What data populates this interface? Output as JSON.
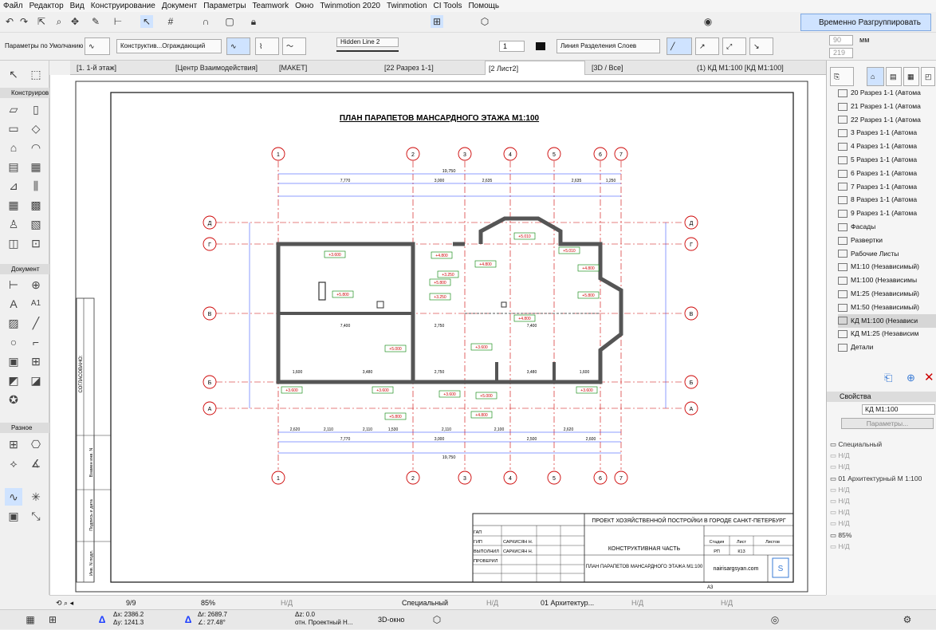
{
  "menu": [
    "Файл",
    "Редактор",
    "Вид",
    "Конструирование",
    "Документ",
    "Параметры",
    "Teamwork",
    "Окно",
    "Twinmotion 2020",
    "Twinmotion",
    "CI Tools",
    "Помощь"
  ],
  "toolbar": {
    "group_button": "Временно Разгруппировать",
    "default_params": "Параметры по Умолчанию",
    "construct_dropdown": "Конструктив...Ограждающий",
    "hidden_line": "Hidden Line 2",
    "pen_number": "1",
    "layer_line": "Линия Разделения Слоев",
    "unit_mm": "мм",
    "val_90": "90",
    "val_219": "219"
  },
  "tabs": [
    {
      "label": "[1. 1-й этаж]"
    },
    {
      "label": "[Центр Взаимодействия]"
    },
    {
      "label": "[МАКЕТ]"
    },
    {
      "label": "[22 Разрез 1-1]"
    },
    {
      "label": "[2 Лист2]"
    },
    {
      "label": "[3D / Все]"
    },
    {
      "label": "(1) КД М1:100 [КД М1:100]"
    }
  ],
  "left_sections": {
    "construct": "Конструиров",
    "document": "Документ",
    "misc": "Разное",
    "a1_label": "A1"
  },
  "drawing": {
    "title": "ПЛАН ПАРАПЕТОВ МАНСАРДНОГО ЭТАЖА  М1:100",
    "axes_vertical": [
      "1",
      "2",
      "3",
      "4",
      "5",
      "6",
      "7"
    ],
    "axes_horizontal": [
      "Д",
      "Г",
      "В",
      "Б",
      "А"
    ],
    "dim_total": "19,750",
    "dims_top": [
      "7,770",
      "3,000",
      "2,635",
      "2,635",
      "1,250"
    ],
    "dims_bottom_row1": [
      "2,620",
      "2,110",
      "2,110",
      "1,530",
      "2,110",
      "2,100",
      "2,620"
    ],
    "dims_bottom_row2": [
      "7,770",
      "3,000",
      "2,500",
      "2,600"
    ],
    "dims_inner": [
      "7,400",
      "2,750",
      "7,400",
      "1,600",
      "3,480",
      "2,750",
      "3,480",
      "1,600"
    ],
    "marks": [
      "+3.600",
      "+3.600",
      "+3.600",
      "+3.600",
      "+3.600",
      "+3.600",
      "+4.800",
      "+4.800",
      "+4.800",
      "+4.800",
      "+5.000",
      "+5.000",
      "+5.800",
      "+5.800",
      "+5.800",
      "+5.800",
      "+3.250",
      "+3.250",
      "+4.800",
      "+5.010",
      "+5.010"
    ],
    "side_label": "СОГЛАСОВАНО:",
    "stamp_side": [
      "Взамен инв. N",
      "Подпись и дата",
      "Инв. N подл."
    ],
    "stamp": {
      "project": "ПРОЕКТ ХОЗЯЙСТВЕННОЙ ПОСТРОЙКИ В ГОРОДЕ САНКТ-ПЕТЕРБУРГ",
      "part": "КОНСТРУКТИВНАЯ ЧАСТЬ",
      "stage_h": "Стадия",
      "sheet_h": "Лист",
      "sheets_h": "Листов",
      "stage": "РП",
      "sheet": "К13",
      "sheet_title": "ПЛАН ПАРАПЕТОВ МАНСАРДНОГО ЭТАЖА М1:100",
      "site": "nairisargsyan.com",
      "rows": [
        {
          "role": "ГАП",
          "name": ""
        },
        {
          "role": "ГИП",
          "name": "САРКИСЯН Н."
        },
        {
          "role": "ВЫПОЛНИЛ",
          "name": "САРКИСЯН Н."
        },
        {
          "role": "ПРОВЕРИЛ",
          "name": ""
        }
      ],
      "format": "А3"
    }
  },
  "navigator": {
    "items": [
      {
        "label": "20 Разрез 1-1 (Автома",
        "sel": false
      },
      {
        "label": "21 Разрез 1-1 (Автома",
        "sel": false
      },
      {
        "label": "22 Разрез 1-1 (Автома",
        "sel": false
      },
      {
        "label": "3 Разрез 1-1 (Автома",
        "sel": false
      },
      {
        "label": "4 Разрез 1-1 (Автома",
        "sel": false
      },
      {
        "label": "5 Разрез 1-1 (Автома",
        "sel": false
      },
      {
        "label": "6 Разрез 1-1 (Автома",
        "sel": false
      },
      {
        "label": "7 Разрез 1-1 (Автома",
        "sel": false
      },
      {
        "label": "8 Разрез 1-1 (Автома",
        "sel": false
      },
      {
        "label": "9 Разрез 1-1 (Автома",
        "sel": false
      },
      {
        "label": "Фасады",
        "sel": false
      },
      {
        "label": "Развертки",
        "sel": false
      },
      {
        "label": "Рабочие Листы",
        "sel": false
      },
      {
        "label": "М1:10 (Независимый)",
        "sel": false
      },
      {
        "label": "М1:100 (Независимы",
        "sel": false
      },
      {
        "label": "М1:25 (Независимый)",
        "sel": false
      },
      {
        "label": "М1:50 (Независимый)",
        "sel": false
      },
      {
        "label": "КД М1:100 (Независи",
        "sel": true
      },
      {
        "label": "КД М1:25 (Независим",
        "sel": false
      },
      {
        "label": "Детали",
        "sel": false
      }
    ]
  },
  "properties": {
    "header": "Свойства",
    "name_value": "КД М1:100",
    "params_button": "Параметры...",
    "rows": [
      {
        "label": "Специальный",
        "dim": false
      },
      {
        "label": "Н/Д",
        "dim": true
      },
      {
        "label": "Н/Д",
        "dim": true
      },
      {
        "label": "01 Архитектурный М 1:100",
        "dim": false
      },
      {
        "label": "Н/Д",
        "dim": true
      },
      {
        "label": "Н/Д",
        "dim": true
      },
      {
        "label": "Н/Д",
        "dim": true
      },
      {
        "label": "Н/Д",
        "dim": true
      },
      {
        "label": "85%",
        "dim": false
      },
      {
        "label": "Н/Д",
        "dim": true
      }
    ]
  },
  "status": {
    "pages": "9/9",
    "zoom": "85%",
    "nd1": "Н/Д",
    "special": "Специальный",
    "nd2": "Н/Д",
    "arch": "01 Архитектур...",
    "nd3": "Н/Д",
    "nd4": "Н/Д"
  },
  "bottom": {
    "dx": "Δx: 2386.2",
    "dy": "Δy: 1241.3",
    "dr": "Δr: 2689.7",
    "da": "∠: 27.48°",
    "dz": "Δz: 0.0",
    "ref": "отн. Проектный Н...",
    "view3d": "3D-окно"
  },
  "colors": {
    "accent": "#cc0000",
    "blue": "#1a3cff",
    "green": "#008000"
  }
}
